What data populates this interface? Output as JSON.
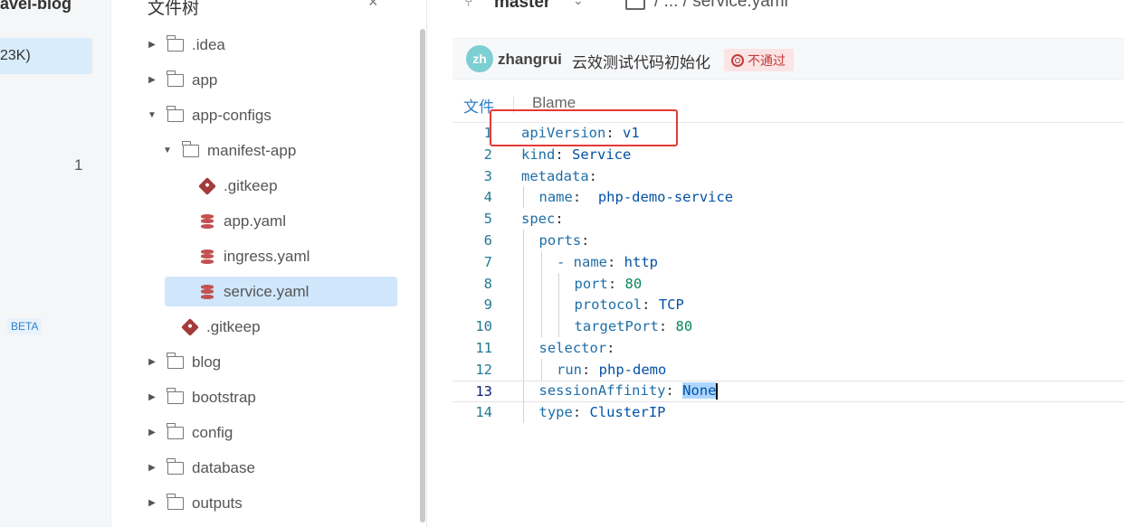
{
  "left_rail": {
    "title": "avel-blog",
    "selected_label": "23K)",
    "count": "1",
    "beta": "BETA"
  },
  "tree": {
    "title": "文件树",
    "close_glyph": "×",
    "items": [
      {
        "label": ".idea",
        "type": "folder",
        "expanded": false,
        "depth": 0
      },
      {
        "label": "app",
        "type": "folder",
        "expanded": false,
        "depth": 0
      },
      {
        "label": "app-configs",
        "type": "folder",
        "expanded": true,
        "depth": 0
      },
      {
        "label": "manifest-app",
        "type": "folder",
        "expanded": true,
        "depth": 1
      },
      {
        "label": ".gitkeep",
        "type": "git",
        "depth": 2
      },
      {
        "label": "app.yaml",
        "type": "db",
        "depth": 2
      },
      {
        "label": "ingress.yaml",
        "type": "db",
        "depth": 2
      },
      {
        "label": "service.yaml",
        "type": "db",
        "depth": 2,
        "selected": true
      },
      {
        "label": ".gitkeep",
        "type": "git",
        "depth": 1
      },
      {
        "label": "blog",
        "type": "folder",
        "expanded": false,
        "depth": 0
      },
      {
        "label": "bootstrap",
        "type": "folder",
        "expanded": false,
        "depth": 0
      },
      {
        "label": "config",
        "type": "folder",
        "expanded": false,
        "depth": 0
      },
      {
        "label": "database",
        "type": "folder",
        "expanded": false,
        "depth": 0
      },
      {
        "label": "outputs",
        "type": "folder",
        "expanded": false,
        "depth": 0
      }
    ]
  },
  "topbar": {
    "branch": "master",
    "crumb": "/ ... / service.yaml"
  },
  "commit": {
    "avatar": "zh",
    "author": "zhangrui",
    "message": "云效测试代码初始化",
    "status": "不通过"
  },
  "tabs": {
    "file": "文件",
    "blame": "Blame"
  },
  "code": [
    {
      "n": "1",
      "indent": 0,
      "key": "apiVersion",
      "val": "v1"
    },
    {
      "n": "2",
      "indent": 0,
      "key": "kind",
      "val": "Service"
    },
    {
      "n": "3",
      "indent": 0,
      "key": "metadata",
      "val": ""
    },
    {
      "n": "4",
      "indent": 1,
      "key": "name",
      "val": " php-demo-service"
    },
    {
      "n": "5",
      "indent": 0,
      "key": "spec",
      "val": ""
    },
    {
      "n": "6",
      "indent": 1,
      "key": "ports",
      "val": ""
    },
    {
      "n": "7",
      "indent": 2,
      "key": "- name",
      "val": "http"
    },
    {
      "n": "8",
      "indent": 3,
      "key": "port",
      "val": "80"
    },
    {
      "n": "9",
      "indent": 3,
      "key": "protocol",
      "val": "TCP"
    },
    {
      "n": "10",
      "indent": 3,
      "key": "targetPort",
      "val": "80"
    },
    {
      "n": "11",
      "indent": 1,
      "key": "selector",
      "val": ""
    },
    {
      "n": "12",
      "indent": 2,
      "key": "run",
      "val": "php-demo"
    },
    {
      "n": "13",
      "indent": 1,
      "key": "sessionAffinity",
      "val": "None",
      "current": true
    },
    {
      "n": "14",
      "indent": 1,
      "key": "type",
      "val": "ClusterIP"
    }
  ],
  "colors": {
    "accent": "#2d7fc7",
    "selected_bg": "#cfe6fb",
    "status_bg": "#fbe4e4",
    "status_fg": "#c23b3b",
    "highlight_box": "#e53935"
  }
}
